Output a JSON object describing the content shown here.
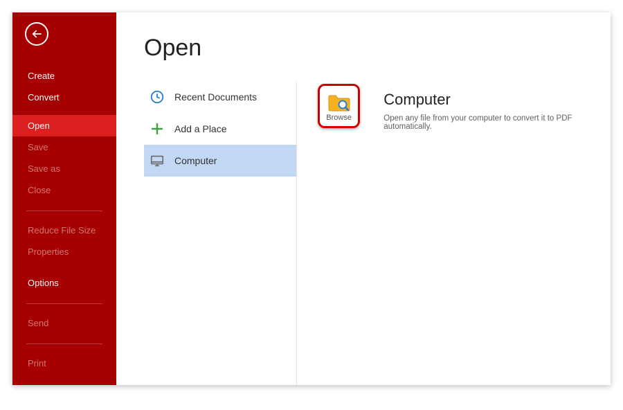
{
  "page": {
    "title": "Open"
  },
  "sidebar": {
    "items": [
      {
        "label": "Create",
        "enabled": true,
        "active": false
      },
      {
        "label": "Convert",
        "enabled": true,
        "active": false
      },
      {
        "label": "Open",
        "enabled": true,
        "active": true
      },
      {
        "label": "Save",
        "enabled": false,
        "active": false
      },
      {
        "label": "Save as",
        "enabled": false,
        "active": false
      },
      {
        "label": "Close",
        "enabled": false,
        "active": false
      },
      {
        "label": "Reduce File Size",
        "enabled": false,
        "active": false
      },
      {
        "label": "Properties",
        "enabled": false,
        "active": false
      },
      {
        "label": "Options",
        "enabled": true,
        "active": false
      },
      {
        "label": "Send",
        "enabled": false,
        "active": false
      },
      {
        "label": "Print",
        "enabled": false,
        "active": false
      }
    ]
  },
  "places": {
    "items": [
      {
        "label": "Recent Documents",
        "icon": "clock-icon",
        "selected": false
      },
      {
        "label": "Add a Place",
        "icon": "plus-icon",
        "selected": false
      },
      {
        "label": "Computer",
        "icon": "computer-icon",
        "selected": true
      }
    ]
  },
  "detail": {
    "browse_label": "Browse",
    "title": "Computer",
    "description": "Open any file from your computer to convert it to PDF automatically."
  },
  "colors": {
    "sidebar_bg": "#a60000",
    "sidebar_active": "#dc2020",
    "selection_bg": "#c3d8f4",
    "highlight_border": "#d10000"
  }
}
